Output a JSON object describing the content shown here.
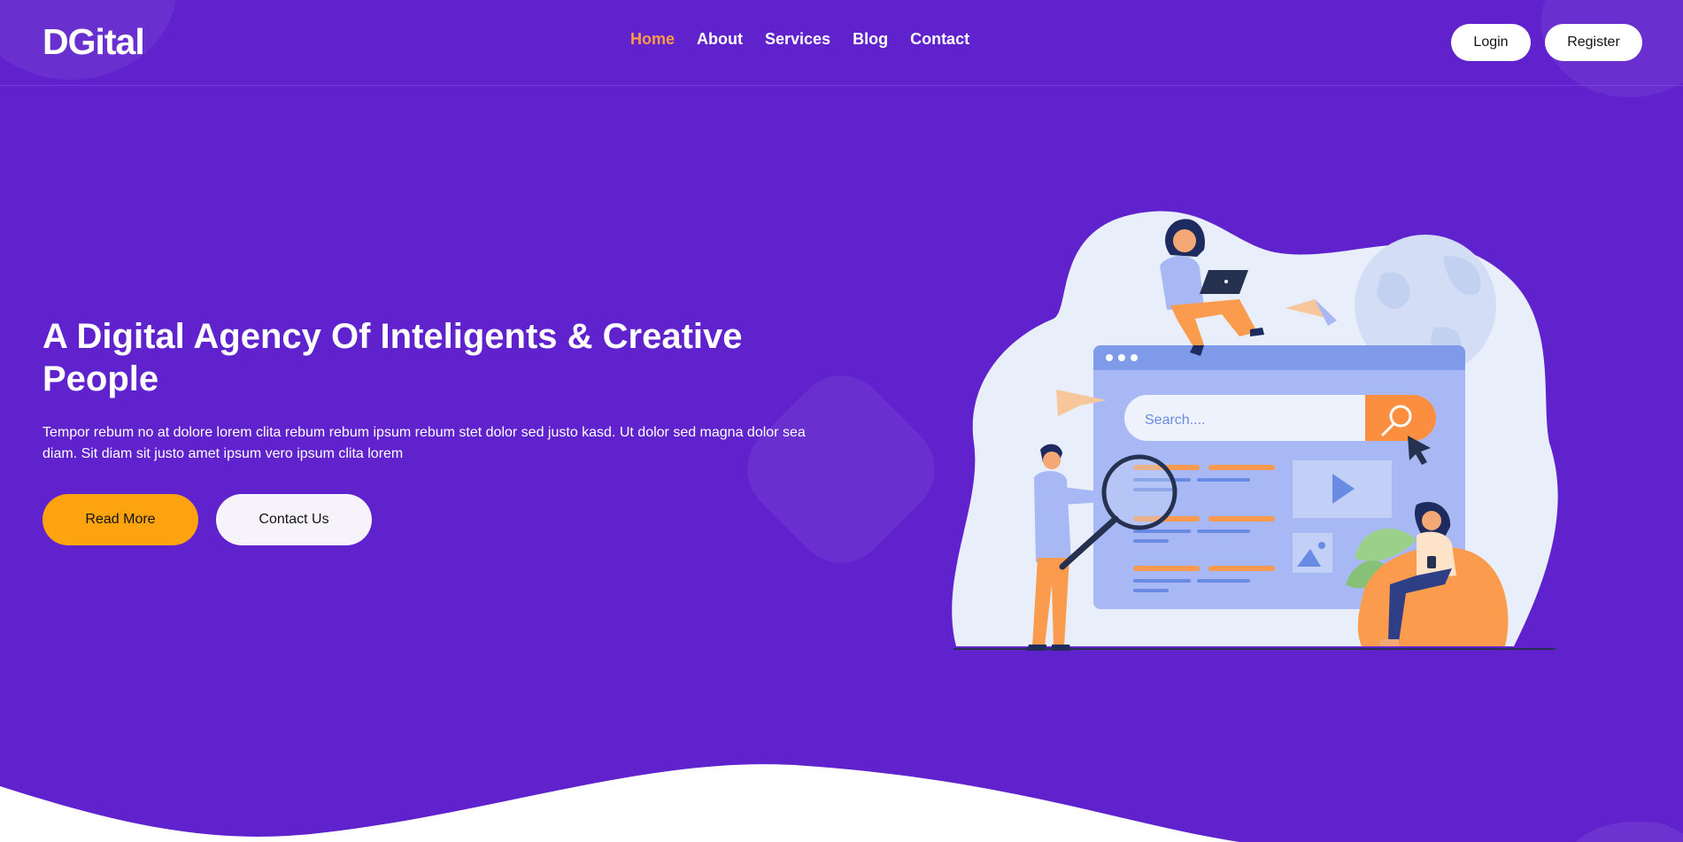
{
  "brand": {
    "name": "DGital"
  },
  "nav": {
    "items": [
      {
        "label": "Home",
        "active": true
      },
      {
        "label": "About",
        "active": false
      },
      {
        "label": "Services",
        "active": false
      },
      {
        "label": "Blog",
        "active": false
      },
      {
        "label": "Contact",
        "active": false
      }
    ]
  },
  "auth": {
    "login_label": "Login",
    "register_label": "Register"
  },
  "hero": {
    "title": "A Digital Agency Of Inteligents & Creative People",
    "text": "Tempor rebum no at dolore lorem clita rebum rebum ipsum rebum stet dolor sed justo kasd. Ut dolor sed magna dolor sea diam. Sit diam sit justo amet ipsum vero ipsum clita lorem",
    "primary_button": "Read More",
    "secondary_button": "Contact Us"
  },
  "illustration": {
    "search_placeholder": "Search....",
    "icons": [
      "search-icon",
      "cursor-icon",
      "play-icon",
      "image-icon",
      "magnifying-glass-icon",
      "paper-plane-icon",
      "globe-icon",
      "plant-icon",
      "laptop-icon"
    ]
  },
  "colors": {
    "background": "#6022cd",
    "accent_nav_active": "#ff9a47",
    "primary_button": "#fca30f",
    "white": "#ffffff"
  }
}
